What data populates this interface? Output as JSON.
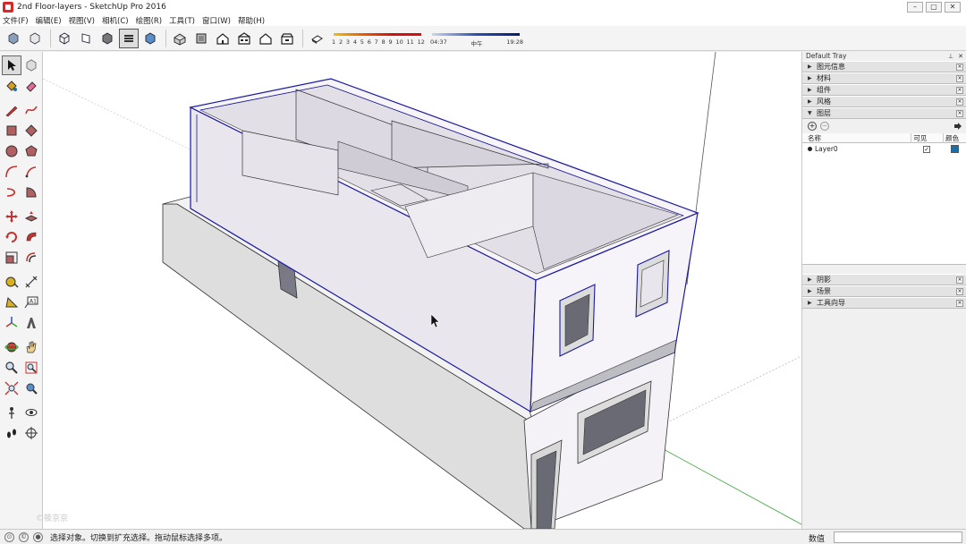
{
  "window": {
    "title": "2nd Floor-layers - SketchUp Pro 2016"
  },
  "menu": {
    "items": [
      "文件(F)",
      "编辑(E)",
      "视图(V)",
      "相机(C)",
      "绘图(R)",
      "工具(T)",
      "窗口(W)",
      "帮助(H)"
    ]
  },
  "toolbar": {
    "tool_icons": [
      "xray-icon",
      "back-edges-icon",
      "wireframe-icon",
      "hidden-line-icon",
      "shaded-icon",
      "shaded-textures-icon",
      "monochrome-icon"
    ],
    "view_icons": [
      "iso-view-icon",
      "top-view-icon",
      "front-view-icon",
      "right-view-icon",
      "back-view-icon",
      "left-view-icon"
    ],
    "shadow_toggle_icon": "shadow-settings-icon",
    "months": [
      "1",
      "2",
      "3",
      "4",
      "5",
      "6",
      "7",
      "8",
      "9",
      "10",
      "11",
      "12"
    ],
    "time_start": "04:37",
    "time_mid": "中午",
    "time_end": "19:28"
  },
  "tray": {
    "title": "Default Tray",
    "panels_top": [
      {
        "label": "图元信息",
        "expanded": false
      },
      {
        "label": "材料",
        "expanded": false
      },
      {
        "label": "组件",
        "expanded": false
      },
      {
        "label": "风格",
        "expanded": false
      },
      {
        "label": "图层",
        "expanded": true
      }
    ],
    "layers": {
      "col_name": "名称",
      "col_visible": "可见",
      "col_color": "颜色",
      "rows": [
        {
          "name": "Layer0",
          "visible": true,
          "color": "#1a6fa8"
        }
      ]
    },
    "panels_bottom": [
      {
        "label": "阴影"
      },
      {
        "label": "场景"
      },
      {
        "label": "工具向导"
      }
    ]
  },
  "status": {
    "message": "选择对象。切换到扩充选择。拖动鼠标选择多项。",
    "vcb_label": "数值",
    "vcb_value": ""
  },
  "viewport": {
    "watermark": "©筱京京",
    "selection_color": "#1a1aa0",
    "green_axis_color": "#3aa83a"
  }
}
